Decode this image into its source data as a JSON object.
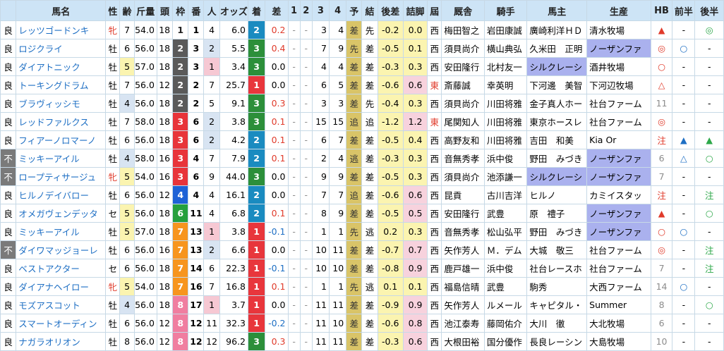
{
  "headers": [
    "",
    "馬名",
    "性",
    "齢",
    "斤量",
    "頭",
    "枠",
    "番",
    "人",
    "オッズ",
    "着",
    "差",
    "1",
    "2",
    "3",
    "4",
    "予",
    "結",
    "後差",
    "詰脚",
    "屆",
    "厩舎",
    "騎手",
    "馬主",
    "生産",
    "HB",
    "前半",
    "後半"
  ],
  "rows": [
    [
      "良",
      "レッツゴードンキ",
      "牝",
      "7",
      "54.0",
      "18",
      "1",
      "1",
      "4",
      "6.0",
      "2",
      "0.2",
      "-",
      "-",
      "3",
      "4",
      "差",
      "先",
      "-0.2",
      "0.0",
      "西",
      "梅田智之",
      "岩田康誠",
      "廣崎利洋ＨＤ",
      "清水牧場",
      "▲",
      "-",
      "◎"
    ],
    [
      "良",
      "ロジクライ",
      "牡",
      "6",
      "56.0",
      "18",
      "2",
      "3",
      "2",
      "5.5",
      "3",
      "0.4",
      "-",
      "-",
      "7",
      "9",
      "先",
      "差",
      "-0.5",
      "0.1",
      "西",
      "須貝尚介",
      "横山典弘",
      "久米田　正明",
      "ノーザンファ",
      "◎",
      "○",
      "-"
    ],
    [
      "良",
      "ダイアトニック",
      "牡",
      "5",
      "57.0",
      "18",
      "2",
      "3",
      "1",
      "3.4",
      "3",
      "0.0",
      "-",
      "-",
      "4",
      "4",
      "差",
      "差",
      "-0.3",
      "0.3",
      "西",
      "安田隆行",
      "北村友一",
      "シルクレーシ",
      "酒井牧場",
      "○",
      "-",
      "-"
    ],
    [
      "良",
      "トーキングドラム",
      "牡",
      "7",
      "56.0",
      "12",
      "2",
      "2",
      "7",
      "25.7",
      "1",
      "0.0",
      "-",
      "-",
      "6",
      "5",
      "差",
      "差",
      "-0.6",
      "0.6",
      "東",
      "斎藤誠",
      "幸英明",
      "下河邊　美智",
      "下河辺牧場",
      "△",
      "-",
      "-"
    ],
    [
      "良",
      "ブラヴィッシモ",
      "牡",
      "4",
      "56.0",
      "18",
      "2",
      "2",
      "5",
      "9.1",
      "3",
      "0.3",
      "-",
      "-",
      "3",
      "3",
      "差",
      "先",
      "-0.4",
      "0.3",
      "西",
      "須貝尚介",
      "川田将雅",
      "金子真人ホー",
      "社台ファーム",
      "11",
      "-",
      "-"
    ],
    [
      "良",
      "レッドファルクス",
      "牡",
      "7",
      "58.0",
      "18",
      "3",
      "6",
      "2",
      "3.8",
      "3",
      "0.1",
      "-",
      "-",
      "15",
      "15",
      "追",
      "追",
      "-1.2",
      "1.2",
      "東",
      "尾関知人",
      "川田将雅",
      "東京ホースレ",
      "社台ファーム",
      "◎",
      "-",
      "-"
    ],
    [
      "良",
      "フィアーノロマーノ",
      "牡",
      "6",
      "56.0",
      "18",
      "3",
      "6",
      "2",
      "4.2",
      "2",
      "0.1",
      "-",
      "-",
      "6",
      "7",
      "差",
      "差",
      "-0.5",
      "0.4",
      "西",
      "高野友和",
      "川田将雅",
      "吉田　和美",
      "Kia Or",
      "注",
      "▲",
      "▲"
    ],
    [
      "不",
      "ミッキーアイル",
      "牡",
      "4",
      "58.0",
      "16",
      "3",
      "4",
      "7",
      "7.9",
      "2",
      "0.1",
      "-",
      "-",
      "2",
      "4",
      "逃",
      "差",
      "-0.3",
      "0.3",
      "西",
      "音無秀孝",
      "浜中俊",
      "野田　みづき",
      "ノーザンファ",
      "6",
      "△",
      "○"
    ],
    [
      "不",
      "ロープティサージュ",
      "牝",
      "5",
      "54.0",
      "16",
      "3",
      "6",
      "9",
      "44.0",
      "3",
      "0.0",
      "-",
      "-",
      "9",
      "9",
      "差",
      "差",
      "-0.5",
      "0.3",
      "西",
      "須貝尚介",
      "池添謙一",
      "シルクレーシ",
      "ノーザンファ",
      "7",
      "-",
      "-"
    ],
    [
      "良",
      "ヒルノデイバロー",
      "牡",
      "6",
      "56.0",
      "12",
      "4",
      "4",
      "4",
      "16.1",
      "2",
      "0.0",
      "-",
      "-",
      "7",
      "7",
      "追",
      "差",
      "-0.6",
      "0.6",
      "西",
      "昆貢",
      "古川吉洋",
      "ヒルノ",
      "カミイスタッ",
      "注",
      "-",
      "注"
    ],
    [
      "良",
      "オメガヴェンデッタ",
      "セ",
      "5",
      "56.0",
      "18",
      "6",
      "11",
      "4",
      "6.8",
      "2",
      "0.1",
      "-",
      "-",
      "8",
      "9",
      "差",
      "差",
      "-0.5",
      "0.5",
      "西",
      "安田隆行",
      "武豊",
      "原　禮子",
      "ノーザンファ",
      "▲",
      "-",
      "○"
    ],
    [
      "良",
      "ミッキーアイル",
      "牡",
      "5",
      "57.0",
      "18",
      "7",
      "13",
      "1",
      "3.8",
      "1",
      "-0.1",
      "-",
      "-",
      "1",
      "1",
      "先",
      "逃",
      "0.2",
      "0.3",
      "西",
      "音無秀孝",
      "松山弘平",
      "野田　みづき",
      "ノーザンファ",
      "○",
      "○",
      "-"
    ],
    [
      "不",
      "ダイワマッジョーレ",
      "牡",
      "6",
      "56.0",
      "16",
      "7",
      "13",
      "2",
      "6.6",
      "1",
      "0.0",
      "-",
      "-",
      "10",
      "11",
      "差",
      "差",
      "-0.7",
      "0.7",
      "西",
      "矢作芳人",
      "Ｍ．デム",
      "大城　敬三",
      "社台ファーム",
      "◎",
      "-",
      "注"
    ],
    [
      "良",
      "ベストアクター",
      "セ",
      "6",
      "56.0",
      "18",
      "7",
      "14",
      "6",
      "22.3",
      "1",
      "-0.1",
      "-",
      "-",
      "10",
      "10",
      "差",
      "差",
      "-0.8",
      "0.9",
      "西",
      "鹿戸雄一",
      "浜中俊",
      "社台レースホ",
      "社台ファーム",
      "7",
      "-",
      "注"
    ],
    [
      "良",
      "ダイアナヘイロー",
      "牝",
      "5",
      "54.0",
      "18",
      "7",
      "16",
      "7",
      "16.8",
      "1",
      "0.1",
      "-",
      "-",
      "1",
      "1",
      "先",
      "逃",
      "0.1",
      "0.1",
      "西",
      "福島信晴",
      "武豊",
      "駒秀",
      "大西ファーム",
      "14",
      "○",
      "-"
    ],
    [
      "良",
      "モズアスコット",
      "牡",
      "4",
      "56.0",
      "18",
      "8",
      "17",
      "1",
      "3.7",
      "1",
      "0.0",
      "-",
      "-",
      "11",
      "11",
      "差",
      "差",
      "-0.9",
      "0.9",
      "西",
      "矢作芳人",
      "ルメール",
      "キャピタル・",
      "Summer",
      "8",
      "-",
      "○"
    ],
    [
      "良",
      "スマートオーディン",
      "牡",
      "6",
      "56.0",
      "12",
      "8",
      "12",
      "11",
      "32.3",
      "1",
      "-0.2",
      "-",
      "-",
      "11",
      "10",
      "差",
      "差",
      "-0.6",
      "0.8",
      "西",
      "池江泰寿",
      "藤岡佑介",
      "大川　徹",
      "大北牧場",
      "6",
      "-",
      "-"
    ],
    [
      "良",
      "ナガラオリオン",
      "牡",
      "8",
      "56.0",
      "12",
      "8",
      "12",
      "12",
      "96.2",
      "3",
      "0.3",
      "-",
      "-",
      "11",
      "11",
      "差",
      "差",
      "-0.3",
      "0.6",
      "西",
      "大根田裕",
      "国分優作",
      "長良レーシン",
      "大島牧場",
      "10",
      "-",
      "-"
    ]
  ]
}
